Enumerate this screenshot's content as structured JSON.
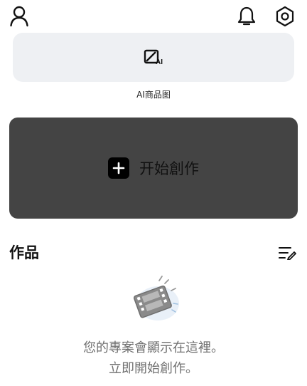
{
  "top_bar": {
    "profile_icon": "person-outline-icon",
    "notifications_icon": "bell-icon",
    "settings_icon": "hexagon-gear-icon"
  },
  "ai_product_card": {
    "icon": "edit-ai-icon",
    "label": "AI商品图"
  },
  "create_card": {
    "icon": "plus-square-icon",
    "label": "开始創作",
    "background": "#444444"
  },
  "works_section": {
    "title": "作品",
    "sort_icon": "list-edit-icon"
  },
  "empty_state": {
    "illustration": "film-strip-icon",
    "line1": "您的專案會顯示在這裡。",
    "line2": "立即開始創作。"
  }
}
